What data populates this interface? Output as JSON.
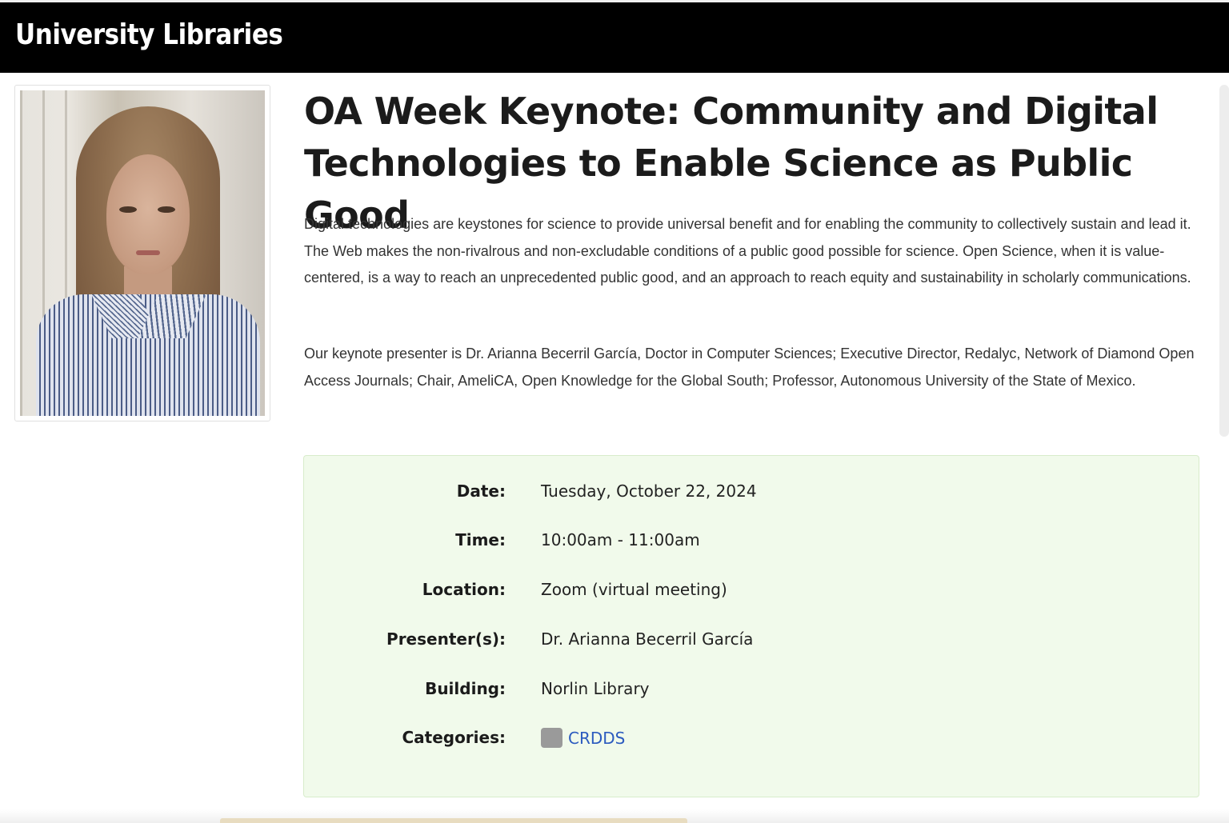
{
  "header": {
    "site_title": "University Libraries"
  },
  "event": {
    "title": "OA Week Keynote: Community and Digital Technologies to Enable Science as Public Good",
    "description_p1": "Digital technologies are keystones for science to provide universal benefit and for enabling the community to collectively sustain and lead it. The Web makes the non-rivalrous and non-excludable conditions of a public good possible for science. Open Science, when it is value-centered, is a way to reach an unprecedented public good, and an approach to reach equity and sustainability in scholarly communications.",
    "description_p2": "Our keynote presenter is Dr. Arianna Becerril García, Doctor in Computer Sciences; Executive Director, Redalyc, Network of Diamond Open Access Journals; Chair, AmeliCA, Open Knowledge for the Global South; Professor, Autonomous University of the State of Mexico.",
    "photo_alt": "presenter-photo"
  },
  "details": {
    "date_label": "Date:",
    "date_value": "Tuesday, October 22, 2024",
    "time_label": "Time:",
    "time_value": "10:00am - 11:00am",
    "location_label": "Location:",
    "location_value": "Zoom (virtual meeting)",
    "presenter_label": "Presenter(s):",
    "presenter_value": "Dr. Arianna Becerril García",
    "building_label": "Building:",
    "building_value": "Norlin Library",
    "categories_label": "Categories:",
    "category_name": "CRDDS",
    "category_color": "#9a9a9a"
  },
  "colors": {
    "header_bg": "#000000",
    "details_bg": "#f1faeb",
    "link": "#2c5bbf"
  }
}
